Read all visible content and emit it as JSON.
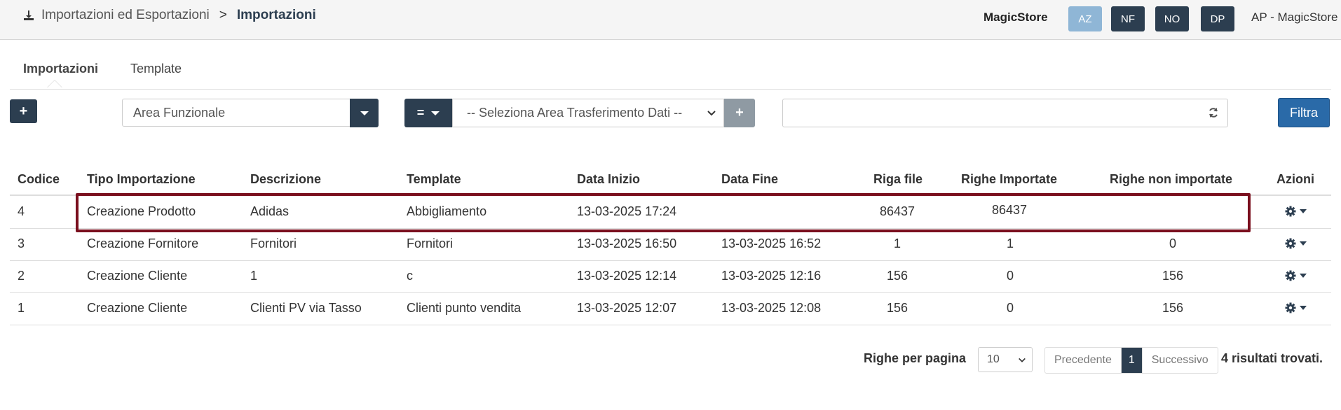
{
  "breadcrumb": {
    "parent": "Importazioni ed Esportazioni",
    "separator": ">",
    "current": "Importazioni"
  },
  "header": {
    "store": "MagicStore",
    "user_buttons": [
      "AZ",
      "NF",
      "NO",
      "DP"
    ],
    "account": "AP - MagicStore"
  },
  "tabs": [
    "Importazioni",
    "Template"
  ],
  "filters": {
    "area_placeholder": "Area Funzionale",
    "operator": "=",
    "transfer_select": "-- Seleziona Area Trasferimento Dati --",
    "search_value": "",
    "filter_button": "Filtra"
  },
  "table": {
    "headers": [
      "Codice",
      "Tipo Importazione",
      "Descrizione",
      "Template",
      "Data Inizio",
      "Data Fine",
      "Riga file",
      "Righe Importate",
      "Righe non importate",
      "Azioni"
    ],
    "rows": [
      [
        "4",
        "Creazione Prodotto",
        "Adidas",
        "Abbigliamento",
        "13-03-2025 17:24",
        "",
        "86437",
        "86437",
        ""
      ],
      [
        "3",
        "Creazione Fornitore",
        "Fornitori",
        "Fornitori",
        "13-03-2025 16:50",
        "13-03-2025 16:52",
        "1",
        "1",
        "0"
      ],
      [
        "2",
        "Creazione Cliente",
        "1",
        "c",
        "13-03-2025 12:14",
        "13-03-2025 12:16",
        "156",
        "0",
        "156"
      ],
      [
        "1",
        "Creazione Cliente",
        "Clienti PV via Tasso",
        "Clienti punto vendita",
        "13-03-2025 12:07",
        "13-03-2025 12:08",
        "156",
        "0",
        "156"
      ]
    ]
  },
  "pagination": {
    "rows_label": "Righe per pagina",
    "rows_value": "10",
    "prev": "Precedente",
    "page": "1",
    "next": "Successivo",
    "results": "4 risultati trovati."
  },
  "colors": {
    "dark": "#2c3e50",
    "primary": "#2a6aa8",
    "highlight": "#7a0f1e",
    "light_badge": "#8fb6d6"
  }
}
